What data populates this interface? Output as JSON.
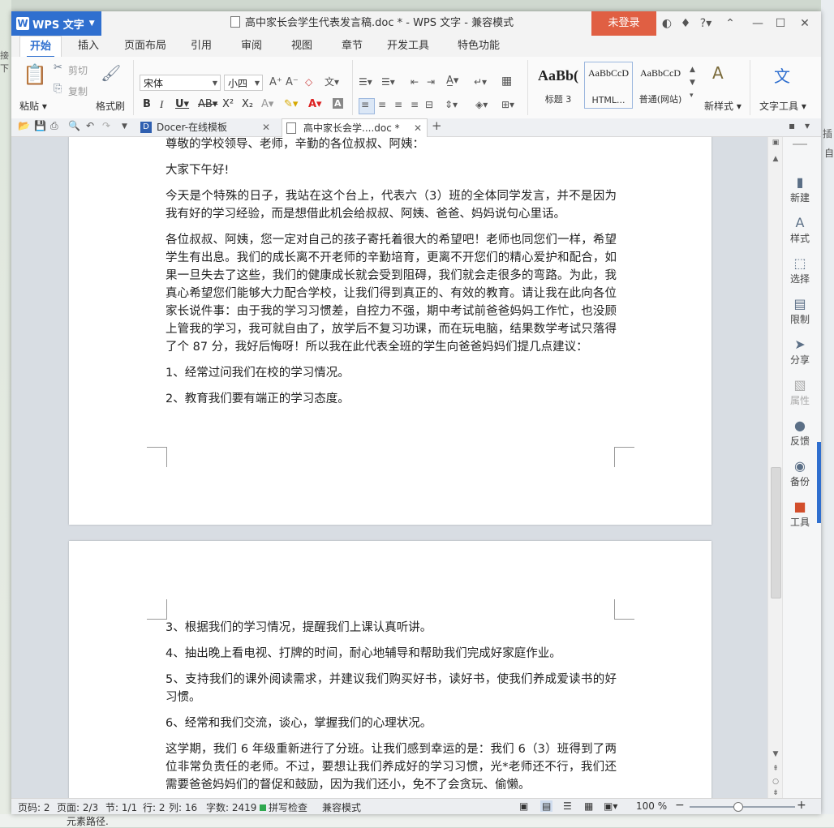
{
  "desktop": {
    "bottom_text": "元素路径.",
    "peek_right_1": "插",
    "peek_right_2": "自",
    "peek_left": "接下"
  },
  "titlebar": {
    "app_name": "WPS 文字",
    "doc_title": "高中家长会学生代表发言稿.doc * - WPS 文字 - 兼容模式",
    "login_label": "未登录"
  },
  "ribbon_tabs": [
    "开始",
    "插入",
    "页面布局",
    "引用",
    "审阅",
    "视图",
    "章节",
    "开发工具",
    "特色功能"
  ],
  "ribbon": {
    "paste": "粘贴",
    "cut": "剪切",
    "copy": "复制",
    "format_painter": "格式刷",
    "font_name": "宋体",
    "font_size": "小四",
    "styles": [
      {
        "preview": "AaBb(",
        "caption": "标题 3"
      },
      {
        "preview": "AaBbCcD",
        "caption": "HTML..."
      },
      {
        "preview": "AaBbCcD",
        "caption": "普通(网站)"
      }
    ],
    "new_style": "新样式",
    "text_tools": "文字工具"
  },
  "doc_tabs": [
    {
      "label": "Docer-在线模板"
    },
    {
      "label": "高中家长会学....doc *"
    }
  ],
  "page1": {
    "paragraphs": [
      "尊敬的学校领导、老师，辛勤的各位叔叔、阿姨：",
      "大家下午好!",
      "今天是个特殊的日子，我站在这个台上，代表六（3）班的全体同学发言，并不是因为我有好的学习经验，而是想借此机会给叔叔、阿姨、爸爸、妈妈说句心里话。",
      "各位叔叔、阿姨，您一定对自己的孩子寄托着很大的希望吧！老师也同您们一样，希望学生有出息。我们的成长离不开老师的辛勤培育，更离不开您们的精心爱护和配合，如果一旦失去了这些，我们的健康成长就会受到阻碍，我们就会走很多的弯路。为此，我真心希望您们能够大力配合学校，让我们得到真正的、有效的教育。请让我在此向各位家长说件事：由于我的学习习惯差，自控力不强，期中考试前爸爸妈妈工作忙，也没顾上管我的学习，我可就自由了，放学后不复习功课，而在玩电脑，结果数学考试只落得了个 87 分，我好后悔呀！所以我在此代表全班的学生向爸爸妈妈们提几点建议：",
      "1、经常过问我们在校的学习情况。",
      "2、教育我们要有端正的学习态度。"
    ]
  },
  "page2": {
    "paragraphs": [
      "3、根据我们的学习情况，提醒我们上课认真听讲。",
      "4、抽出晚上看电视、打牌的时间，耐心地辅导和帮助我们完成好家庭作业。",
      "5、支持我们的课外阅读需求，并建议我们购买好书，读好书，使我们养成爱读书的好习惯。",
      "6、经常和我们交流，谈心，掌握我们的心理状况。",
      "这学期，我们 6 年级重新进行了分班。让我们感到幸运的是：我们 6（3）班得到了两位非常负责任的老师。不过，要想让我们养成好的学习习惯，光*老师还不行，我们还需要爸爸妈妈们的督促和鼓励，因为我们还小，免不了会贪玩、偷懒。"
    ]
  },
  "side_panel": [
    "新建",
    "样式",
    "选择",
    "限制",
    "分享",
    "属性",
    "反馈",
    "备份",
    "工具"
  ],
  "status": {
    "page_num": "页码: 2",
    "pages": "页面: 2/3",
    "section": "节: 1/1",
    "row": "行: 2",
    "col": "列: 16",
    "word_count": "字数: 2419",
    "spell_check": "拼写检查",
    "compat_mode": "兼容模式",
    "zoom": "100 %"
  },
  "colors": {
    "accent": "#2f6fcf",
    "login": "#e05f43",
    "tool": "#d24e2c"
  }
}
